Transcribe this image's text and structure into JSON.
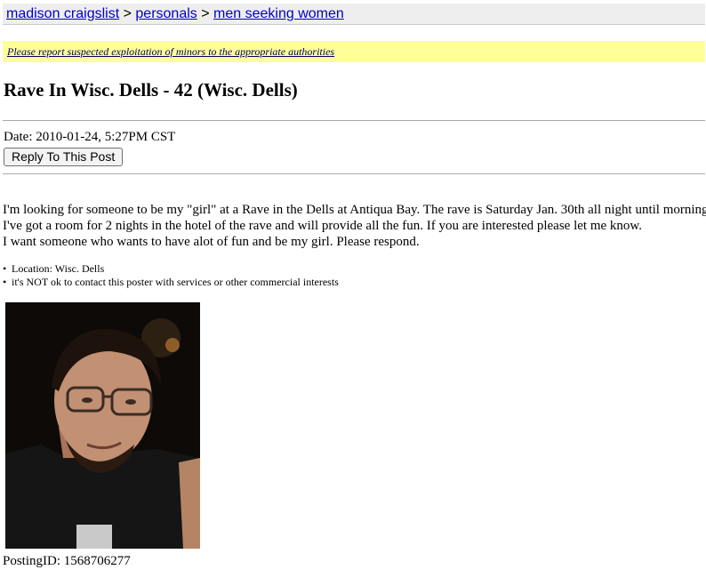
{
  "breadcrumb": {
    "site": "madison craigslist",
    "sep1": ">",
    "section": "personals",
    "sep2": ">",
    "category": "men seeking women"
  },
  "notice": "Please report suspected exploitation of minors to the appropriate authorities",
  "post": {
    "title": "Rave In Wisc. Dells - 42 (Wisc. Dells)",
    "date": "Date: 2010-01-24, 5:27PM CST",
    "reply_button": "Reply To This Post",
    "body_lines": [
      "I'm looking for someone to be my \"girl\" at a Rave in the Dells at Antiqua Bay. The rave is Saturday Jan. 30th all night until morning.",
      "I've got a room for 2 nights in the hotel of the rave and will provide all the fun. If you are interested please let me know.",
      "I want someone who wants to have alot of fun and be my girl. Please respond."
    ],
    "info": [
      "Location: Wisc. Dells",
      "it's NOT ok to contact this poster with services or other commercial interests"
    ],
    "posting_id": "PostingID: 1568706277"
  },
  "colors": {
    "link": "#0000cc",
    "notice_bg": "#ffff99",
    "header_bg": "#eeeeee"
  }
}
